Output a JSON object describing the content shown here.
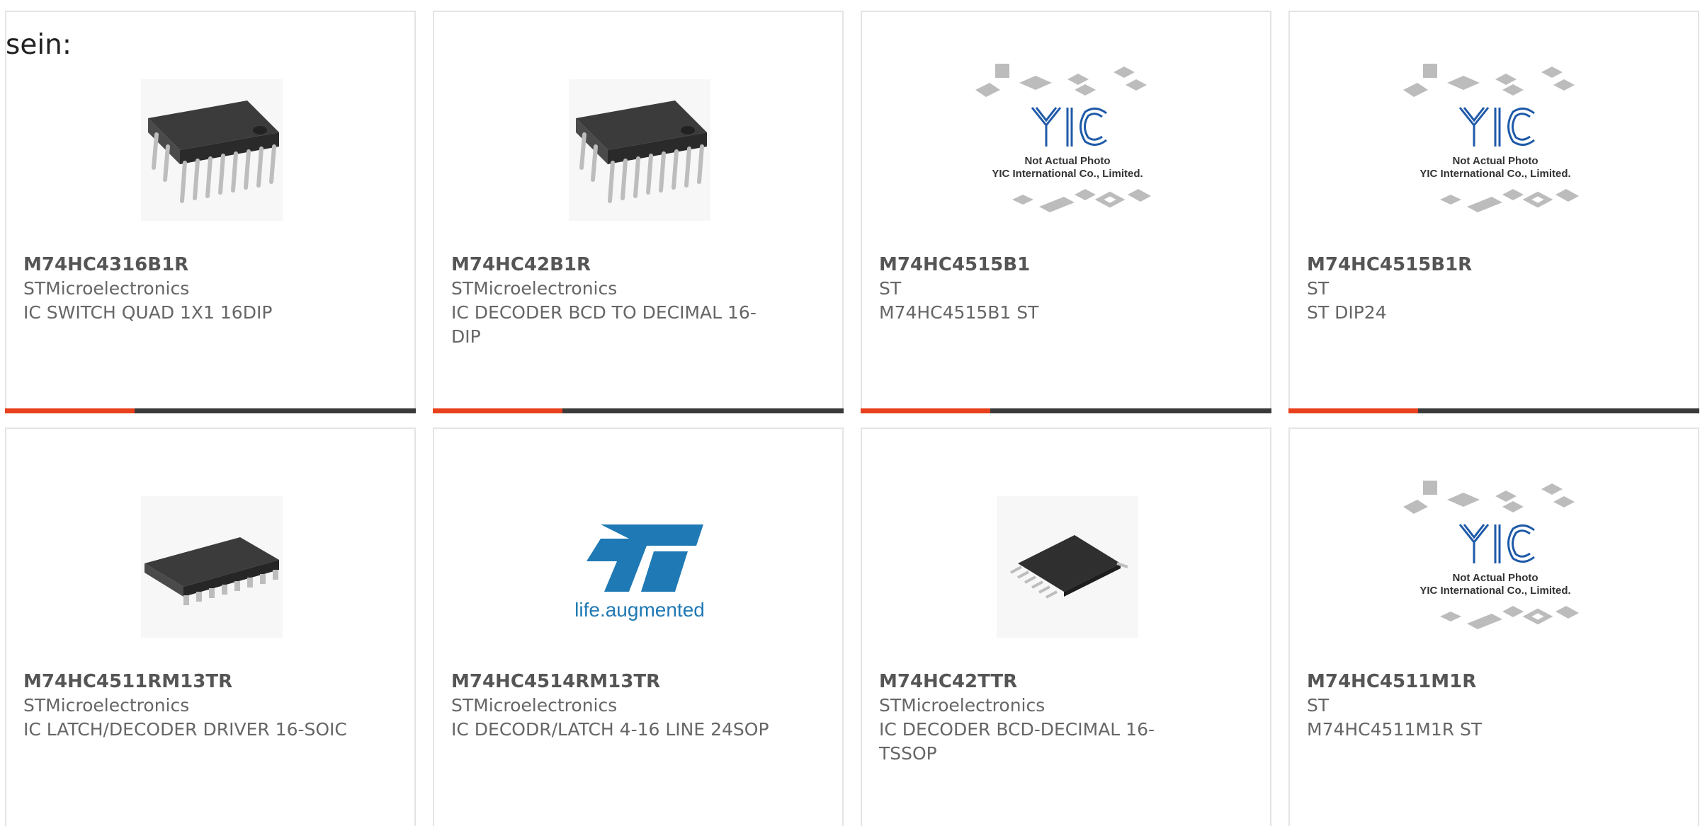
{
  "intro_text": "sein:",
  "colors": {
    "accent": "#e8401c",
    "bar_dark": "#3a3a3a",
    "card_border": "#e4e4e4",
    "text": "#555555"
  },
  "products": [
    {
      "part_number": "M74HC4316B1R",
      "manufacturer": "STMicroelectronics",
      "description": "IC SWITCH QUAD 1X1 16DIP",
      "image": "dip16-chip-icon"
    },
    {
      "part_number": "M74HC42B1R",
      "manufacturer": "STMicroelectronics",
      "description": "IC DECODER BCD TO DECIMAL 16-DIP",
      "image": "dip16-chip-icon"
    },
    {
      "part_number": "M74HC4515B1",
      "manufacturer": "ST",
      "description": "M74HC4515B1 ST",
      "image": "yic-placeholder",
      "placeholder_line1": "Not Actual Photo",
      "placeholder_line2": "YIC International Co., Limited."
    },
    {
      "part_number": "M74HC4515B1R",
      "manufacturer": "ST",
      "description": "ST DIP24",
      "image": "yic-placeholder",
      "placeholder_line1": "Not Actual Photo",
      "placeholder_line2": "YIC International Co., Limited."
    },
    {
      "part_number": "M74HC4511RM13TR",
      "manufacturer": "STMicroelectronics",
      "description": "IC LATCH/DECODER DRIVER 16-SOIC",
      "image": "soic16-chip-icon"
    },
    {
      "part_number": "M74HC4514RM13TR",
      "manufacturer": "STMicroelectronics",
      "description": "IC DECODR/LATCH 4-16 LINE 24SOP",
      "image": "st-logo",
      "logo_text": "life.augmented"
    },
    {
      "part_number": "M74HC42TTR",
      "manufacturer": "STMicroelectronics",
      "description": "IC DECODER BCD-DECIMAL 16-TSSOP",
      "image": "tssop16-chip-icon"
    },
    {
      "part_number": "M74HC4511M1R",
      "manufacturer": "ST",
      "description": "M74HC4511M1R ST",
      "image": "yic-placeholder",
      "placeholder_line1": "Not Actual Photo",
      "placeholder_line2": "YIC International Co., Limited."
    }
  ]
}
